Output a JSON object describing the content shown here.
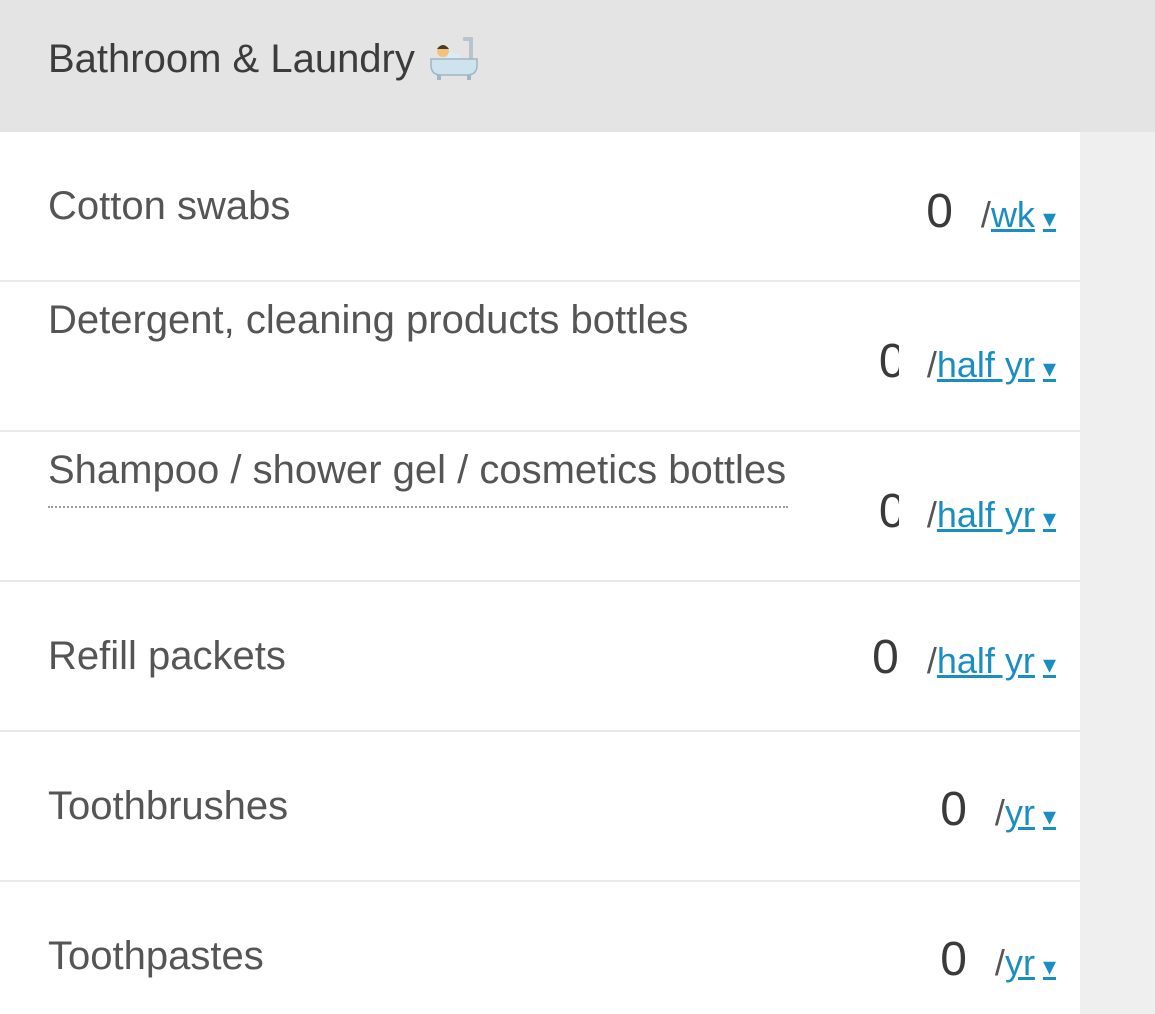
{
  "section": {
    "title": "Bathroom & Laundry",
    "icon": "bathtub-icon"
  },
  "items": [
    {
      "label": "Cotton swabs",
      "quantity": "0",
      "period": "wk"
    },
    {
      "label": "Detergent, cleaning products bottles",
      "quantity": "0",
      "period": "half yr"
    },
    {
      "label": "Shampoo / shower gel / cosmetics bottles",
      "quantity": "0",
      "period": "half yr"
    },
    {
      "label": "Refill packets",
      "quantity": "0",
      "period": "half yr"
    },
    {
      "label": "Toothbrushes",
      "quantity": "0",
      "period": "yr"
    },
    {
      "label": "Toothpastes",
      "quantity": "0",
      "period": "yr"
    }
  ],
  "ui": {
    "unit_prefix": "/",
    "dropdown_caret": "▾"
  },
  "colors": {
    "header_bg": "#e4e4e4",
    "link": "#1a8ec2",
    "text": "#555555"
  }
}
